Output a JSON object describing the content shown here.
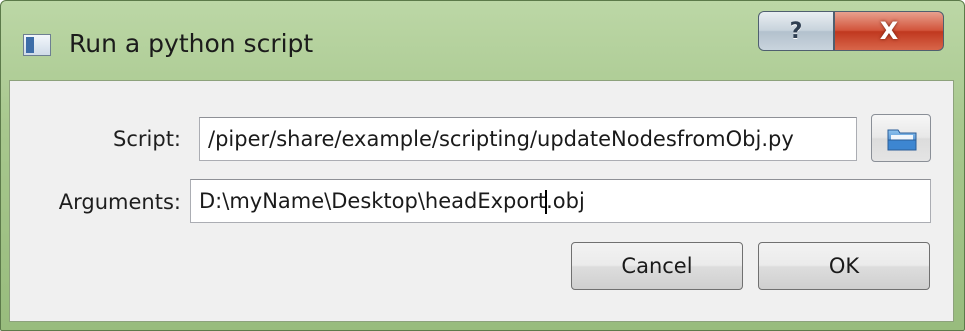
{
  "window": {
    "title": "Run a python script",
    "help_label": "?",
    "close_label": "X"
  },
  "form": {
    "script_label": "Script:",
    "script_value": "/piper/share/example/scripting/updateNodesfromObj.py",
    "arguments_label": "Arguments:",
    "arguments_value_before_caret": "D:\\myName\\Desktop\\headExport",
    "arguments_value_after_caret": ".obj",
    "browse_icon": "folder-open-icon"
  },
  "buttons": {
    "cancel_label": "Cancel",
    "ok_label": "OK"
  }
}
